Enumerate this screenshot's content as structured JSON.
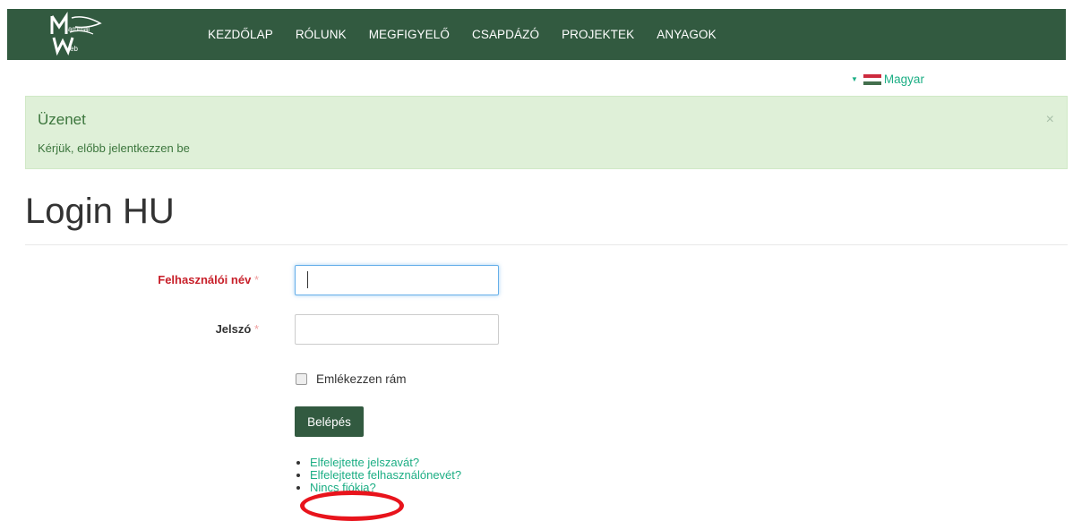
{
  "nav": {
    "items": [
      "KEZDŐLAP",
      "RÓLUNK",
      "MEGFIGYELŐ",
      "CSAPDÁZÓ",
      "PROJEKTEK",
      "ANYAGOK"
    ]
  },
  "language": {
    "label": "Magyar",
    "flag_colors": [
      "#cd2a3e",
      "#ffffff",
      "#436f4d"
    ]
  },
  "alert": {
    "title": "Üzenet",
    "message": "Kérjük, előbb jelentkezzen be",
    "close": "×"
  },
  "page": {
    "title": "Login HU"
  },
  "form": {
    "username_label": "Felhasználói név",
    "password_label": "Jelszó",
    "required_mark": "*",
    "username_value": "",
    "password_value": "",
    "remember_label": "Emlékezzen rám",
    "submit_label": "Belépés"
  },
  "links": [
    "Elfelejtette jelszavát?",
    "Elfelejtette felhasználónevét?",
    "Nincs fiókja?"
  ],
  "colors": {
    "header_bg": "#325a40",
    "accent": "#1cae84",
    "alert_bg": "#dff0d8",
    "required": "#c8202a",
    "annotation": "#e8141c"
  }
}
